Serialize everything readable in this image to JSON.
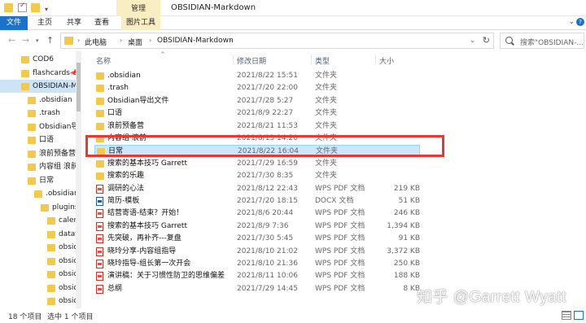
{
  "window": {
    "title": "OBSIDIAN-Markdown",
    "manage_tab": "管理"
  },
  "ribbon": {
    "tabs": [
      "文件",
      "主页",
      "共享",
      "查看",
      "图片工具"
    ],
    "help_label": "?"
  },
  "address": {
    "crumbs": [
      "此电脑",
      "桌面",
      "OBSIDIAN-Markdown"
    ],
    "search_placeholder": "搜索\"OBSIDIAN-..."
  },
  "sidebar": {
    "items": [
      {
        "label": "COD6",
        "indent": 0,
        "pinned": false
      },
      {
        "label": "flashcards-ob",
        "indent": 0,
        "pinned": true
      },
      {
        "label": "OBSIDIAN-Ma",
        "indent": 0,
        "pinned": false,
        "selected": true
      },
      {
        "label": ".obsidian",
        "indent": 1,
        "pinned": false
      },
      {
        "label": ".trash",
        "indent": 1,
        "pinned": false
      },
      {
        "label": "Obsidian导出",
        "indent": 1,
        "pinned": false
      },
      {
        "label": "口语",
        "indent": 1,
        "pinned": false
      },
      {
        "label": "浪前预备营",
        "indent": 1,
        "pinned": false
      },
      {
        "label": "内容组 浪前",
        "indent": 1,
        "pinned": false
      },
      {
        "label": "日常",
        "indent": 1,
        "pinned": false
      },
      {
        "label": ".obsidian",
        "indent": 2,
        "pinned": false
      },
      {
        "label": "plugins",
        "indent": 3,
        "pinned": false
      },
      {
        "label": "calendar",
        "indent": 4,
        "pinned": false
      },
      {
        "label": "dataview",
        "indent": 4,
        "pinned": false
      },
      {
        "label": "obsidian",
        "indent": 4,
        "pinned": false
      },
      {
        "label": "obsidian",
        "indent": 4,
        "pinned": false
      },
      {
        "label": "obsidian",
        "indent": 4,
        "pinned": false
      },
      {
        "label": "obsidian",
        "indent": 4,
        "pinned": false
      },
      {
        "label": "obsidian",
        "indent": 4,
        "pinned": false
      },
      {
        "label": "quickad",
        "indent": 4,
        "pinned": false
      }
    ]
  },
  "columns": {
    "name": "名称",
    "date": "修改日期",
    "type": "类型",
    "size": "大小"
  },
  "files": [
    {
      "name": ".obsidian",
      "date": "2021/8/22 15:51",
      "type": "文件夹",
      "size": "",
      "icon": "folder"
    },
    {
      "name": ".trash",
      "date": "2021/7/20 22:00",
      "type": "文件夹",
      "size": "",
      "icon": "folder"
    },
    {
      "name": "Obsidian导出文件",
      "date": "2021/7/28 5:27",
      "type": "文件夹",
      "size": "",
      "icon": "folder"
    },
    {
      "name": "口语",
      "date": "2021/8/9 22:27",
      "type": "文件夹",
      "size": "",
      "icon": "folder"
    },
    {
      "name": "浪前预备营",
      "date": "2021/8/21 11:53",
      "type": "文件夹",
      "size": "",
      "icon": "folder"
    },
    {
      "name": "内容组 浪前",
      "date": "2021/8/13 14:20",
      "type": "文件夹",
      "size": "",
      "icon": "folder"
    },
    {
      "name": "日常",
      "date": "2021/8/22 16:04",
      "type": "文件夹",
      "size": "",
      "icon": "folder",
      "selected": true
    },
    {
      "name": "搜索的基本技巧 Garrett",
      "date": "2021/7/29 16:59",
      "type": "文件夹",
      "size": "",
      "icon": "folder"
    },
    {
      "name": "搜索的乐趣",
      "date": "2021/7/30 8:35",
      "type": "文件夹",
      "size": "",
      "icon": "folder"
    },
    {
      "name": "调研的心法",
      "date": "2021/8/12 22:43",
      "type": "WPS PDF 文档",
      "size": "219 KB",
      "icon": "pdf"
    },
    {
      "name": "简历-模板",
      "date": "2021/7/20 18:15",
      "type": "DOCX 文档",
      "size": "51 KB",
      "icon": "docx"
    },
    {
      "name": "结营寄语-结束？开始！",
      "date": "2021/8/6 20:44",
      "type": "WPS PDF 文档",
      "size": "246 KB",
      "icon": "pdf"
    },
    {
      "name": "搜索的基本技巧 Garrett",
      "date": "2021/8/9 7:36",
      "type": "WPS PDF 文档",
      "size": "1,394 KB",
      "icon": "pdf"
    },
    {
      "name": "先突破，再补齐---复盘",
      "date": "2021/7/30 5:45",
      "type": "WPS PDF 文档",
      "size": "91 KB",
      "icon": "pdf"
    },
    {
      "name": "晓玲分享-内容组指导",
      "date": "2021/8/10 21:02",
      "type": "WPS PDF 文档",
      "size": "3,372 KB",
      "icon": "pdf"
    },
    {
      "name": "晓玲指导-组长第一次开会",
      "date": "2021/8/10 21:36",
      "type": "WPS PDF 文档",
      "size": "250 KB",
      "icon": "pdf"
    },
    {
      "name": "演讲稿：关于习惯性防卫的思维偏差",
      "date": "2021/8/11 10:06",
      "type": "WPS PDF 文档",
      "size": "188 KB",
      "icon": "pdf"
    },
    {
      "name": "总纲",
      "date": "2021/7/29 14:45",
      "type": "WPS PDF 文档",
      "size": "8 KB",
      "icon": "pdf"
    }
  ],
  "status": {
    "count": "18 个项目",
    "selected": "选中 1 个项目"
  },
  "watermark": "知乎 @Garrett Wyatt",
  "colors": {
    "file_tab": "#1a73c8",
    "manage_tab": "#f8eec2",
    "selection": "#cce8ff",
    "highlight_box": "#e53935",
    "folder": "#f2c94c"
  }
}
